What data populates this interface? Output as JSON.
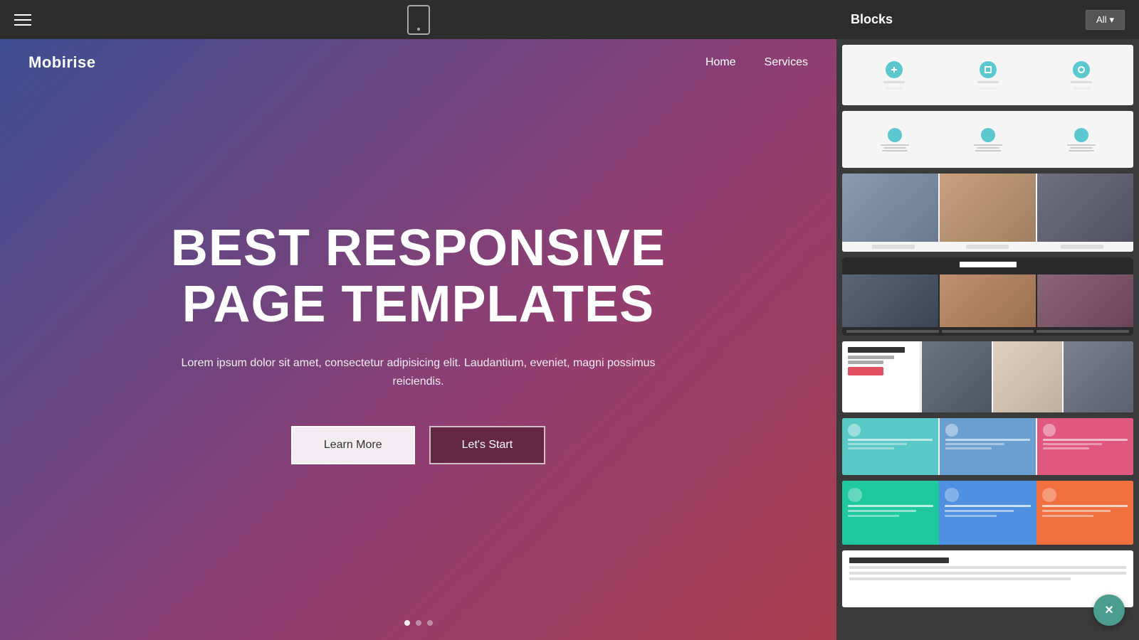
{
  "toolbar": {
    "hamburger_label": "menu",
    "device_label": "mobile preview"
  },
  "hero": {
    "brand": "Mobirise",
    "nav_links": [
      {
        "label": "Home"
      },
      {
        "label": "Services"
      }
    ],
    "title_line1": "BEST RESPONSIVE",
    "title_line2": "PAGE TEMPLATES",
    "subtitle": "Lorem ipsum dolor sit amet, consectetur adipisicing elit. Laudantium, eveniet, magni possimus reiciendis.",
    "btn_learn_more": "Learn More",
    "btn_lets_start": "Let's Start"
  },
  "panel": {
    "title": "Blocks",
    "filter_label": "All",
    "filter_icon": "chevron-down"
  },
  "close_fab_label": "×",
  "blocks": [
    {
      "id": "block-1",
      "type": "icon-features-white"
    },
    {
      "id": "block-2",
      "type": "circle-features-white"
    },
    {
      "id": "block-3",
      "type": "photo-grid-dark"
    },
    {
      "id": "block-4",
      "type": "blog-dark"
    },
    {
      "id": "block-5",
      "type": "development-mixed"
    },
    {
      "id": "block-6",
      "type": "colored-features-teal-blue-pink"
    },
    {
      "id": "block-7",
      "type": "colored-features-teal-blue-orange"
    },
    {
      "id": "block-8",
      "type": "white-text-card"
    }
  ]
}
